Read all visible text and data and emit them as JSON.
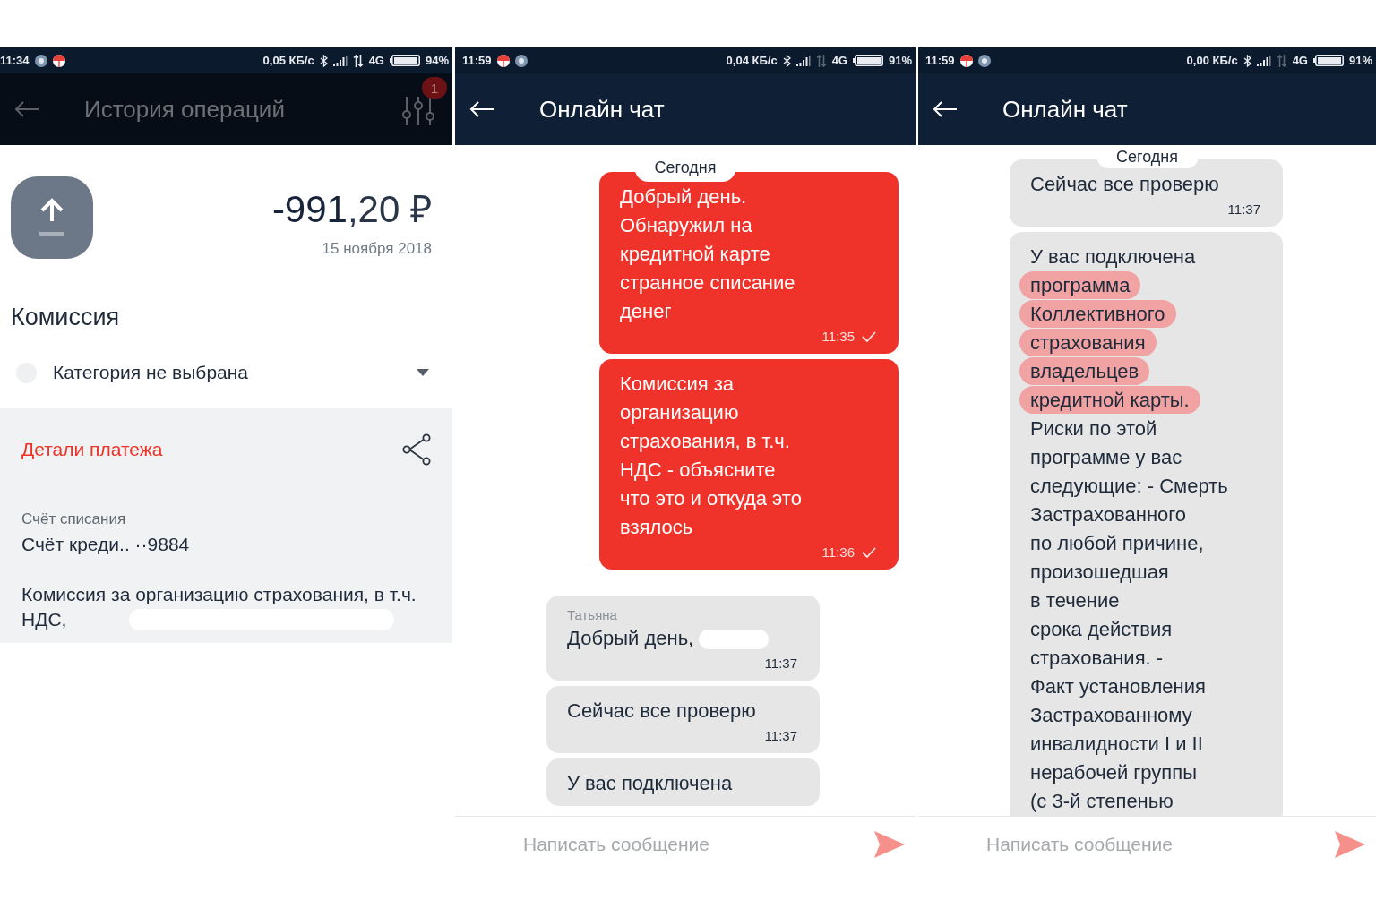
{
  "screens": [
    {
      "kind": "operation",
      "status_bar": {
        "time": "11:34",
        "notifications": [
          {
            "kind": "gear"
          },
          {
            "kind": "flag"
          }
        ],
        "speed": "0,05 КБ/с",
        "data_active": true,
        "network": "4G",
        "battery": "94%"
      },
      "header": {
        "title": "История операций",
        "dimmed": true,
        "filter_badge": "1"
      },
      "amount_main": "-991",
      "amount_fraction": ",20 ₽",
      "date": "15 ноября 2018",
      "category_title": "Комиссия",
      "category_select": "Категория не выбрана",
      "details_title": "Детали платежа",
      "fields": [
        {
          "label": "Счёт списания",
          "value": "Счёт креди.. ··9884"
        }
      ],
      "description": "Комиссия за организацию страхования, в т.ч. НДС,",
      "description_redacted": true
    },
    {
      "kind": "chat",
      "status_bar": {
        "time": "11:59",
        "notifications": [
          {
            "kind": "flag"
          },
          {
            "kind": "gear"
          }
        ],
        "speed": "0,04 КБ/с",
        "data_active": false,
        "network": "4G",
        "battery": "91%"
      },
      "header": {
        "title": "Онлайн чат",
        "dimmed": false
      },
      "date_label": "Сегодня",
      "messages": [
        {
          "outgoing": true,
          "time": "11:35",
          "delivered": true,
          "lines": [
            {
              "text": "Добрый день.",
              "marked": false
            },
            {
              "text": "Обнаружил на",
              "marked": false
            },
            {
              "text": "кредитной карте",
              "marked": false
            },
            {
              "text": "странное списание",
              "marked": false
            },
            {
              "text": "денег",
              "marked": false
            }
          ]
        },
        {
          "outgoing": true,
          "time": "11:36",
          "delivered": true,
          "lines": [
            {
              "text": "Комиссия за",
              "marked": false
            },
            {
              "text": "организацию",
              "marked": false
            },
            {
              "text": "страхования, в т.ч.",
              "marked": false
            },
            {
              "text": "НДС - объясните",
              "marked": false
            },
            {
              "text": "что это и откуда это",
              "marked": false
            },
            {
              "text": "взялось",
              "marked": false
            }
          ]
        },
        {
          "outgoing": false,
          "sender": "Татьяна",
          "time": "11:37",
          "redacted": true,
          "lines": [
            {
              "text": "Добрый день,",
              "marked": false
            }
          ]
        },
        {
          "outgoing": false,
          "time": "11:37",
          "lines": [
            {
              "text": "Сейчас все проверю",
              "marked": false
            }
          ]
        },
        {
          "outgoing": false,
          "lines": [
            {
              "text": "У вас подключена",
              "marked": false
            }
          ]
        }
      ],
      "composer": {
        "placeholder": "Написать сообщение"
      }
    },
    {
      "kind": "chat",
      "status_bar": {
        "time": "11:59",
        "notifications": [
          {
            "kind": "flag"
          },
          {
            "kind": "gear"
          }
        ],
        "speed": "0,00 КБ/с",
        "data_active": false,
        "network": "4G",
        "battery": "91%"
      },
      "header": {
        "title": "Онлайн чат",
        "dimmed": false
      },
      "date_label": "Сегодня",
      "messages": [
        {
          "outgoing": false,
          "time": "11:37",
          "lines": [
            {
              "text": "Сейчас все проверю",
              "marked": false
            }
          ]
        },
        {
          "outgoing": false,
          "lines": [
            {
              "text": "У вас подключена",
              "marked": false
            },
            {
              "text": "программа",
              "marked": true
            },
            {
              "text": "Коллективного",
              "marked": true
            },
            {
              "text": "страхования",
              "marked": true
            },
            {
              "text": "владельцев",
              "marked": true
            },
            {
              "text": "кредитной карты.",
              "marked": true
            },
            {
              "text": "Риски по этой",
              "marked": false
            },
            {
              "text": "программе у вас",
              "marked": false
            },
            {
              "text": "следующие: - Смерть",
              "marked": false
            },
            {
              "text": "Застрахованного",
              "marked": false
            },
            {
              "text": "по любой причине,",
              "marked": false
            },
            {
              "text": "произошедшая",
              "marked": false
            },
            {
              "text": "в течение",
              "marked": false
            },
            {
              "text": "срока действия",
              "marked": false
            },
            {
              "text": "страхования. -",
              "marked": false
            },
            {
              "text": "Факт установления",
              "marked": false
            },
            {
              "text": "Застрахованному",
              "marked": false
            },
            {
              "text": "инвалидности I и II",
              "marked": false
            },
            {
              "text": "нерабочей группы",
              "marked": false
            },
            {
              "text": "(с 3-й степенью",
              "marked": false
            }
          ]
        }
      ],
      "composer": {
        "placeholder": "Написать сообщение"
      }
    }
  ]
}
